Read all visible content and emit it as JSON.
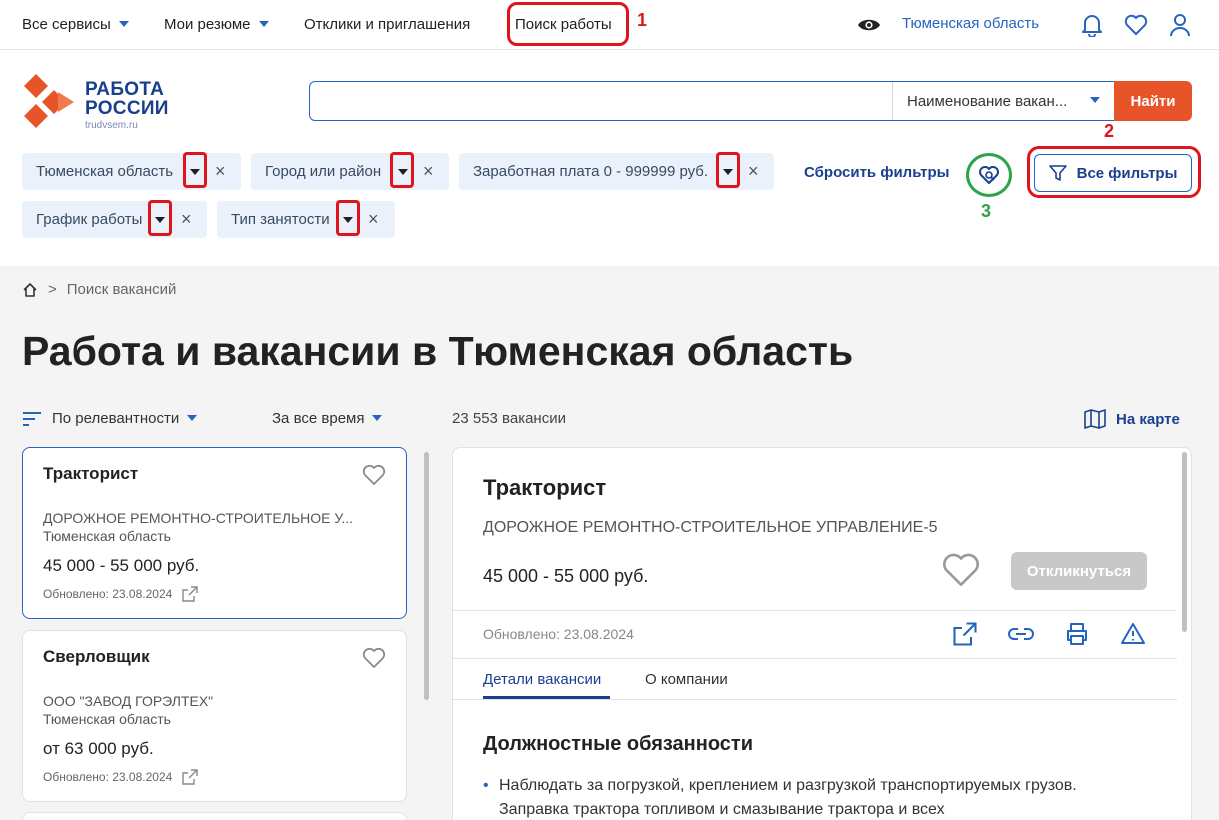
{
  "topnav": {
    "all_services": "Все сервисы",
    "my_resumes": "Мои резюме",
    "responses": "Отклики и приглашения",
    "job_search": "Поиск работы",
    "region": "Тюменская область"
  },
  "annotations": {
    "n1": "1",
    "n2": "2",
    "n3": "3"
  },
  "logo": {
    "line1": "РАБОТА",
    "line2": "РОССИИ",
    "site": "trudvsem.ru"
  },
  "search": {
    "placeholder": "",
    "select_value": "Наименование вакан...",
    "button": "Найти"
  },
  "filters": {
    "chips": [
      {
        "label": "Тюменская область"
      },
      {
        "label": "Город или район"
      },
      {
        "label": "Заработная плата 0 - 999999 руб."
      },
      {
        "label": "График работы"
      },
      {
        "label": "Тип занятости"
      }
    ],
    "close_glyph": "×",
    "reset": "Сбросить фильтры",
    "all_filters": "Все фильтры"
  },
  "breadcrumb": {
    "separator": ">",
    "current": "Поиск вакансий"
  },
  "page_title": "Работа и вакансии в Тюменская область",
  "sort": {
    "relevance": "По релевантности",
    "period": "За все время"
  },
  "count": "23 553 вакансии",
  "map_link": "На карте",
  "cards": [
    {
      "title": "Тракторист",
      "org": "ДОРОЖНОЕ РЕМОНТНО-СТРОИТЕЛЬНОЕ У...",
      "region": "Тюменская область",
      "salary": "45 000 - 55 000 руб.",
      "updated": "Обновлено: 23.08.2024"
    },
    {
      "title": "Сверловщик",
      "org": "ООО \"ЗАВОД ГОРЭЛТЕХ\"",
      "region": "Тюменская область",
      "salary": "от 63 000 руб.",
      "updated": "Обновлено: 23.08.2024"
    }
  ],
  "detail": {
    "title": "Тракторист",
    "org": "ДОРОЖНОЕ РЕМОНТНО-СТРОИТЕЛЬНОЕ УПРАВЛЕНИЕ-5",
    "salary": "45 000 - 55 000 руб.",
    "apply": "Откликнуться",
    "updated": "Обновлено: 23.08.2024",
    "tabs": [
      "Детали вакансии",
      "О компании"
    ],
    "section_title": "Должностные обязанности",
    "bullet": "Наблюдать за погрузкой, креплением и разгрузкой транспортируемых грузов. Заправка трактора топливом и смазывание трактора и всех"
  },
  "colors": {
    "brand_blue": "#1b3f8f",
    "link_blue": "#2565c0",
    "accent_orange": "#e8542a",
    "annotation_red": "#e0141d",
    "annotation_green": "#2da34a"
  }
}
